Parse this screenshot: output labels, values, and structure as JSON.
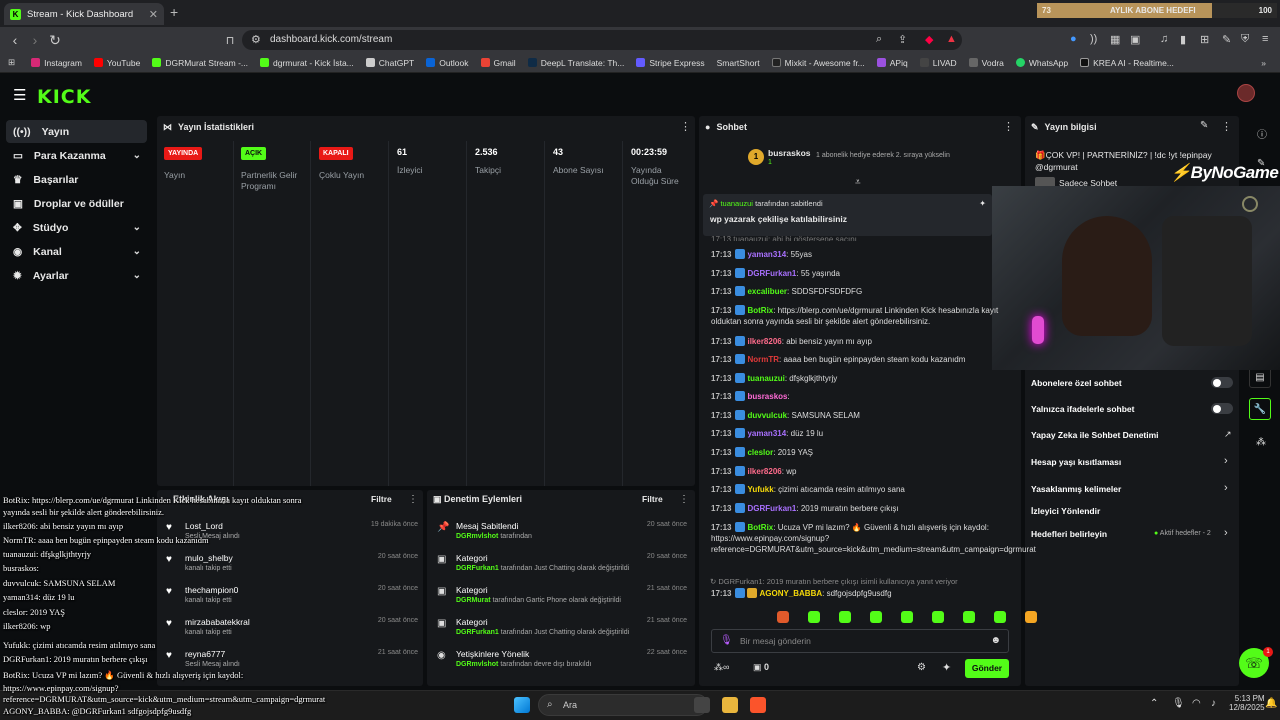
{
  "browser": {
    "tab_title": "Stream - Kick Dashboard",
    "url": "dashboard.kick.com/stream",
    "bookmarks": [
      "Instagram",
      "YouTube",
      "DGRMurat Stream -...",
      "dgrmurat - Kick İsta...",
      "ChatGPT",
      "Outlook",
      "Gmail",
      "DeepL Translate: Th...",
      "Stripe Express",
      "SmartShort",
      "Mixkit - Awesome fr...",
      "APiq",
      "LIVAD",
      "Vodra",
      "WhatsApp",
      "KREA AI - Realtime..."
    ]
  },
  "sub_goal": {
    "current": "73",
    "title": "AYLIK ABONE HEDEFI",
    "target": "100",
    "progress": 0.73
  },
  "sidebar": {
    "items": [
      "Yayın",
      "Para Kazanma",
      "Başarılar",
      "Droplar ve ödüller",
      "Stüdyo",
      "Kanal",
      "Ayarlar"
    ]
  },
  "stats": {
    "title": "Yayın İstatistikleri",
    "items": [
      {
        "badge": "YAYINDA",
        "label": "Yayın",
        "color": "#e91916"
      },
      {
        "badge": "AÇIK",
        "label": "Partnerlik Gelir Programı",
        "color": "#53fc18"
      },
      {
        "badge": "KAPALI",
        "label": "Çoklu Yayın",
        "color": "#e91916"
      },
      {
        "value": "61",
        "label": "İzleyici"
      },
      {
        "value": "2.536",
        "label": "Takipçi"
      },
      {
        "value": "43",
        "label": "Abone Sayısı"
      },
      {
        "value": "00:23:59",
        "label": "Yayında Olduğu Süre"
      }
    ]
  },
  "chat": {
    "title": "Sohbet",
    "top_user": "busraskos",
    "top_count": "1",
    "top_note": "1 abonelik hediye ederek 2. sıraya yükselin",
    "pinned_by": "tuanauzui",
    "pinned_suffix": "tarafından sabitlendi",
    "pinned_msg": "wp yazarak çekilişe katılabilirsiniz",
    "partial_top": "17:13 tuanauzui: abi bi göstersene saçını",
    "messages": [
      {
        "time": "17:13",
        "user": "yaman314",
        "color": "#a970ff",
        "text": "55yas"
      },
      {
        "time": "17:13",
        "user": "DGRFurkan1",
        "color": "#a970ff",
        "text": "55 yaşında"
      },
      {
        "time": "17:13",
        "user": "excalibuer",
        "color": "#53fc18",
        "text": "SDDSFDFSDFDFG"
      },
      {
        "time": "17:13",
        "user": "BotRix",
        "color": "#53fc18",
        "text": "https://blerp.com/ue/dgrmurat Linkinden Kick hesabınızla kayıt olduktan sonra yayında sesli bir şekilde alert gönderebilirsiniz."
      },
      {
        "time": "17:13",
        "user": "ilker8206",
        "color": "#ff6b8b",
        "text": "abi bensiz yayın mı ayıp"
      },
      {
        "time": "17:13",
        "user": "NormTR",
        "color": "#e23a3a",
        "text": "aaaa ben bugün epinpayden steam kodu kazanıdm"
      },
      {
        "time": "17:13",
        "user": "tuanauzui",
        "color": "#53fc18",
        "text": "dfşkglkjthtyrjy"
      },
      {
        "time": "17:13",
        "user": "busraskos",
        "color": "#ff6bd6",
        "text": ""
      },
      {
        "time": "17:13",
        "user": "duvvulcuk",
        "color": "#53fc18",
        "text": "SAMSUNA SELAM"
      },
      {
        "time": "17:13",
        "user": "yaman314",
        "color": "#a970ff",
        "text": "düz 19 lu"
      },
      {
        "time": "17:13",
        "user": "cleslor",
        "color": "#53fc18",
        "text": "2019 YAŞ"
      },
      {
        "time": "17:13",
        "user": "ilker8206",
        "color": "#ff6b8b",
        "text": "wp"
      },
      {
        "time": "17:13",
        "user": "Yufukk",
        "color": "#f5d90a",
        "text": "çizimi atıcamda resim atılmıyo sana"
      },
      {
        "time": "17:13",
        "user": "DGRFurkan1",
        "color": "#a970ff",
        "text": "2019 muratın berbere çıkışı"
      },
      {
        "time": "17:13",
        "user": "BotRix",
        "color": "#53fc18",
        "text": "Ucuza VP mi lazım? 🔥 Güvenli & hızlı alışveriş için kaydol: https://www.epinpay.com/signup?reference=DGRMURAT&utm_source=kick&utm_medium=stream&utm_campaign=dgrmurat"
      }
    ],
    "reply_hint": "DGRFurkan1: 2019 muratın berbere çıkışı isimli kullanıcıya yanıt veriyor",
    "last": {
      "time": "17:13",
      "user": "AGONY_BABBA",
      "text": "sdfgojsdpfg9usdfg"
    },
    "placeholder": "Bir mesaj gönderin",
    "points": "0",
    "send": "Gönder"
  },
  "stream_info": {
    "title": "Yayın bilgisi",
    "stream_title": "🎁ÇOK VP! | PARTNERİNİZ? | !dc !yt !epinpay @dgrmurat",
    "sub_chat": "Sadece Sohbet",
    "brand": "ByNoGame"
  },
  "chat_settings": [
    {
      "label": "Abonelere özel sohbet",
      "type": "toggle"
    },
    {
      "label": "Yalnızca ifadelerle sohbet",
      "type": "toggle"
    },
    {
      "label": "Yapay Zeka ile Sohbet Denetimi",
      "type": "link"
    },
    {
      "label": "Hesap yaşı kısıtlaması",
      "type": "chevron"
    },
    {
      "label": "Yasaklanmış kelimeler",
      "type": "chevron"
    },
    {
      "label": "İzleyici Yönlendir",
      "type": "none"
    },
    {
      "label": "Hedefleri belirleyin",
      "type": "chevron",
      "note": "Aktif hedefler - 2"
    }
  ],
  "activity": {
    "title": "Etkinlik Akışı",
    "filter": "Filtre",
    "items": [
      {
        "name": "Lost_Lord",
        "sub": "Sesli Mesaj alındı",
        "time": "19 dakika önce"
      },
      {
        "name": "mulo_shelby",
        "sub": "kanalı takip etti",
        "time": "20 saat önce"
      },
      {
        "name": "thechampion0",
        "sub": "kanalı takip etti",
        "time": "20 saat önce"
      },
      {
        "name": "mirzababatekkral",
        "sub": "kanalı takip etti",
        "time": "20 saat önce"
      },
      {
        "name": "reyna6777",
        "sub": "Sesli Mesaj alındı",
        "time": "21 saat önce"
      }
    ]
  },
  "moderation": {
    "title": "Denetim Eylemleri",
    "filter": "Filtre",
    "items": [
      {
        "name": "Mesaj Sabitlendi",
        "who": "DGRmvlshot",
        "rest": "tarafından",
        "time": "20 saat önce",
        "icon": "pin-icon"
      },
      {
        "name": "Kategori",
        "who": "DGRFurkan1",
        "rest": "tarafından Just Chatting olarak değiştirildi",
        "time": "20 saat önce",
        "icon": "category-icon"
      },
      {
        "name": "Kategori",
        "who": "DGRMurat",
        "rest": "tarafından Gartic Phone olarak değiştirildi",
        "time": "21 saat önce",
        "icon": "category-icon"
      },
      {
        "name": "Kategori",
        "who": "DGRFurkan1",
        "rest": "tarafından Just Chatting olarak değiştirildi",
        "time": "21 saat önce",
        "icon": "category-icon"
      },
      {
        "name": "Yetişkinlere Yönelik",
        "who": "DGRmvlshot",
        "rest": "tarafından devre dışı bırakıldı",
        "time": "22 saat önce",
        "icon": "eye-icon"
      }
    ]
  },
  "overlay_chat": [
    "BotRix: https://blerp.com/ue/dgrmurat Linkinden Kick hesabınızla kayıt olduktan sonra",
    "yayında sesli bir şekilde alert gönderebilirsiniz.",
    "ilker8206: abi bensiz yayın mı ayıp",
    "NormTR: aaaa ben bugün epinpayden steam kodu kazanıdm",
    "tuanauzui: dfşkglkjthtyrjy",
    "busraskos:",
    "duvvulcuk: SAMSUNA SELAM",
    "yaman314: düz 19 lu",
    "cleslor: 2019 YAŞ",
    "ilker8206: wp",
    "Yufukk: çizimi atıcamda resim atılmıyo sana",
    "DGRFurkan1: 2019 muratın berbere çıkışı",
    "BotRix: Ucuza VP mi lazım? 🔥 Güvenli & hızlı alışveriş için kaydol:",
    "https://www.epinpay.com/signup?",
    "reference=DGRMURAT&utm_source=kick&utm_medium=stream&utm_campaign=dgrmurat",
    "AGONY_BABBA: @DGRFurkan1 sdfgojsdpfg9usdfg"
  ],
  "taskbar": {
    "search": "Ara",
    "time": "5:13 PM",
    "date": "12/8/2025",
    "notif": "1"
  }
}
